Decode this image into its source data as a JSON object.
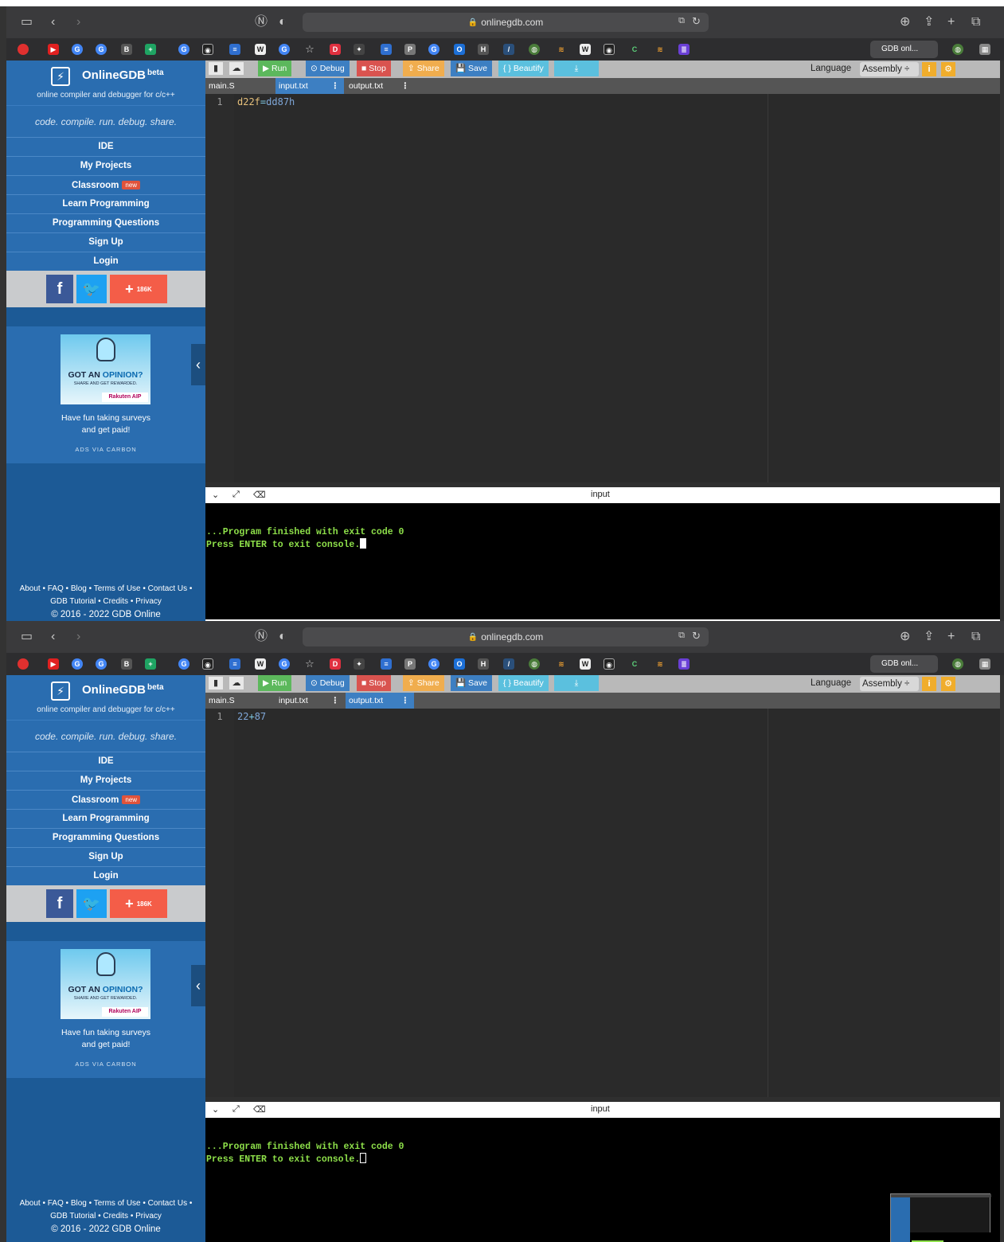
{
  "safari": {
    "url": "onlinegdb.com",
    "lock_icon": "lock-icon",
    "active_tab_label": "GDB onl..."
  },
  "sidebar": {
    "brand": "OnlineGDB",
    "beta": "beta",
    "subtitle": "online compiler and debugger for c/c++",
    "tagline": "code. compile. run. debug. share.",
    "nav": [
      {
        "label": "IDE"
      },
      {
        "label": "My Projects"
      },
      {
        "label": "Classroom",
        "badge": "new"
      },
      {
        "label": "Learn Programming"
      },
      {
        "label": "Programming Questions"
      },
      {
        "label": "Sign Up"
      },
      {
        "label": "Login"
      }
    ],
    "social": {
      "facebook": "f",
      "twitter": "t",
      "plus_count": "186K"
    },
    "ad": {
      "headline_a": "GOT AN ",
      "headline_b": "OPINION?",
      "sub": "SHARE AND GET REWARDED.",
      "brand": "Rakuten AIP",
      "text_line1": "Have fun taking surveys",
      "text_line2": "and get paid!",
      "via": "ADS VIA CARBON"
    },
    "footer": {
      "line1": "About • FAQ • Blog • Terms of Use • Contact Us •",
      "line2": "GDB Tutorial • Credits • Privacy",
      "copyright": "© 2016 - 2022 GDB Online"
    }
  },
  "toolbar": {
    "run": "▶ Run",
    "debug": "⊙ Debug",
    "stop": "■ Stop",
    "share": "⇪ Share",
    "save": "💾 Save",
    "beautify": "{ } Beautify",
    "language_label": "Language",
    "language_value": "Assembly ÷"
  },
  "tabs": [
    "main.S",
    "input.txt",
    "output.txt"
  ],
  "console_title": "input",
  "console_line1": "...Program finished with exit code 0",
  "console_line2": "Press ENTER to exit console.",
  "shots": [
    {
      "active_tab": "input.txt",
      "line_number": "1",
      "code_a": "d22f",
      "code_op": "=",
      "code_b": "dd87h"
    },
    {
      "active_tab": "output.txt",
      "line_number": "1",
      "code_a": "22",
      "code_op": "+",
      "code_b": "87"
    }
  ],
  "colors": {
    "accent_blue": "#2a6db0",
    "run_green": "#5cb85c",
    "stop_red": "#d9534f",
    "share_orange": "#f0ad4e",
    "console_green": "#8ee04a"
  }
}
